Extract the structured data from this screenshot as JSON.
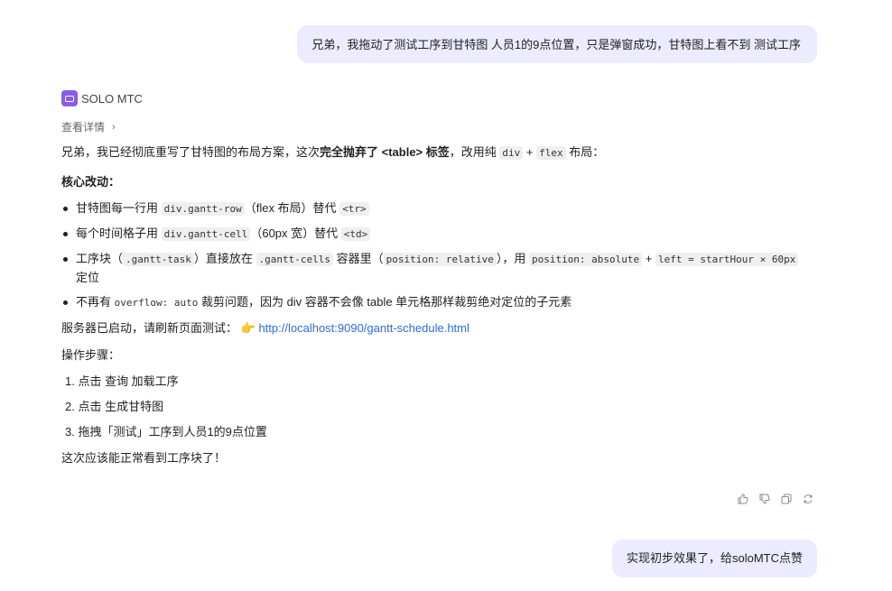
{
  "user_message_1": "兄弟，我拖动了测试工序到甘特图 人员1的9点位置，只是弹窗成功，甘特图上看不到 测试工序",
  "agent": {
    "name": "SOLO MTC",
    "details_label": "查看详情",
    "intro": {
      "pre": "兄弟，我已经彻底重写了甘特图的布局方案，这次",
      "bold": "完全抛弃了 <table> 标签",
      "mid": "，改用纯 ",
      "code1": "div",
      "plus": " + ",
      "code2": "flex",
      "post": " 布局："
    },
    "core_title": "核心改动：",
    "bullets": [
      {
        "a": "甘特图每一行用 ",
        "c1": "div.gantt-row",
        "b": "（flex 布局）替代 ",
        "c2": "<tr>"
      },
      {
        "a": "每个时间格子用 ",
        "c1": "div.gantt-cell",
        "b": "（60px 宽）替代 ",
        "c2": "<td>"
      },
      {
        "a": "工序块（",
        "c1": ".gantt-task",
        "b": "）直接放在 ",
        "c2": ".gantt-cells",
        "c": " 容器里（",
        "c3": "position: relative",
        "d": "），用 ",
        "c4": "position: absolute",
        "e": " + ",
        "c5": "left = startHour × 60px",
        "f": " 定位"
      },
      {
        "a": "不再有 ",
        "c1": "overflow: auto",
        "b": " 裁剪问题，因为 div 容器不会像 table 单元格那样裁剪绝对定位的子元素"
      }
    ],
    "server_text": "服务器已启动，请刷新页面测试：",
    "pointer_emoji": "👉",
    "link": "http://localhost:9090/gantt-schedule.html",
    "steps_title": "操作步骤：",
    "steps": [
      "1. 点击 查询 加载工序",
      "2. 点击 生成甘特图",
      "3. 拖拽「测试」工序到人员1的9点位置"
    ],
    "final_text": "这次应该能正常看到工序块了！"
  },
  "user_message_2": "实现初步效果了，给soloMTC点赞",
  "colors": {
    "user_bubble": "#ECEBFF",
    "link": "#2d6be0",
    "logo": "#8C5BEA"
  },
  "icons": [
    "thumbs-up-icon",
    "thumbs-down-icon",
    "copy-icon",
    "refresh-icon"
  ]
}
